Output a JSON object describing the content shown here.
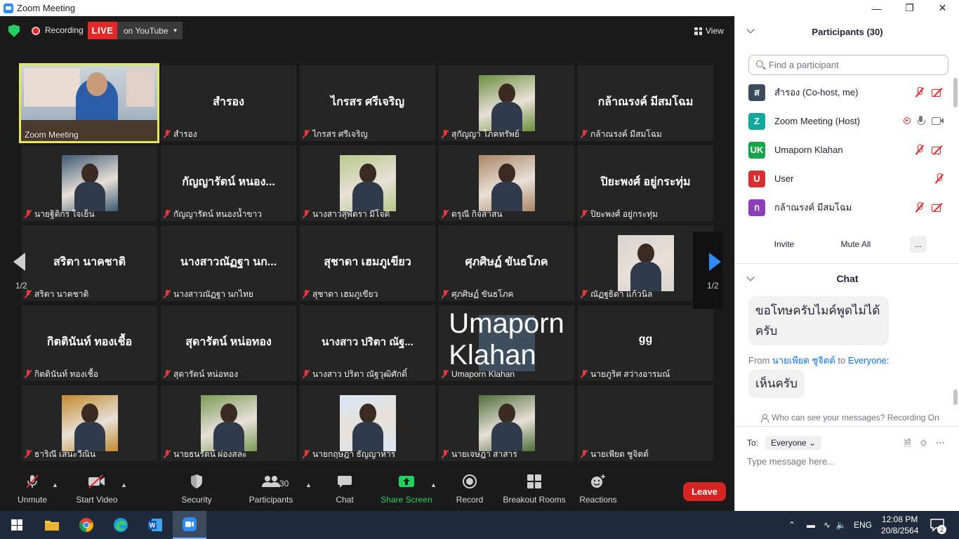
{
  "window": {
    "title": "Zoom Meeting"
  },
  "topbar": {
    "recording_label": "Recording",
    "live_label": "LIVE",
    "live_target": "on YouTube",
    "view_label": "View"
  },
  "self_video_label": "Zoom Meeting",
  "tiles": [
    {
      "name": "สำรอง",
      "label": "สำรอง"
    },
    {
      "name": "ไกรสร ศรีเจริญ",
      "label": "ไกรสร ศรีเจริญ"
    },
    {
      "name": "",
      "label": "สุกัญญา โภคทรัพย์"
    },
    {
      "name": "กล้าณรงค์ มีสมโฉม",
      "label": "กล้าณรงค์ มีสมโฉม"
    },
    {
      "name": "",
      "label": "นายฐิติกร ใจเย็น"
    },
    {
      "name": "กัญญารัตน์ หนอง...",
      "label": "กัญญารัตน์ หนองน้ำขาว"
    },
    {
      "name": "",
      "label": "นางสาวสุพัตรา มีโจติ"
    },
    {
      "name": "",
      "label": "ดรุณี กิจสาสน"
    },
    {
      "name": "ปิยะพงศ์ อยู่กระทุ่ม",
      "label": "ปิยะพงศ์ อยู่กระทุ่ม"
    },
    {
      "name": "สริตา  นาคชาติ",
      "label": "สริตา  นาคชาติ"
    },
    {
      "name": "นางสาวณัฏฐา นก...",
      "label": "นางสาวณัฏฐา นกไทย"
    },
    {
      "name": "สุชาดา เฮมภูเขียว",
      "label": "สุชาดา เฮมภูเขียว"
    },
    {
      "name": "ศุภศิษฏ์ ขันธโภค",
      "label": "ศุภศิษฏ์ ขันธโภค"
    },
    {
      "name": "",
      "label": "ณัฏฐธิดา แก้วนิล"
    },
    {
      "name": "กิตตินันท์ ทองเชื้อ",
      "label": "กิตตินันท์ ทองเชื้อ"
    },
    {
      "name": "สุดารัตน์ หน่อทอง",
      "label": "สุดารัตน์ หน่อทอง"
    },
    {
      "name": "นางสาว ปริตา ณัฐ...",
      "label": "นางสาว ปริตา ณัฐวุฒิศักดิ์"
    },
    {
      "name": "Umaporn Klahan",
      "label": "Umaporn Klahan"
    },
    {
      "name": "gg",
      "label": "นายภูริศ สว่างอารมณ์"
    },
    {
      "name": "ธาริณี เสนะวีณิน",
      "label": "ธาริณี เสนะวีณิน"
    },
    {
      "name": "",
      "label": "นายธนรัตน์ ผ่องสละ"
    },
    {
      "name": "",
      "label": "นายกฤษฎา ธัญญาหาร"
    },
    {
      "name": "",
      "label": "นายเจษฎา สาสาร"
    },
    {
      "name": "",
      "label": "นายเพียด ชูจิตต์"
    }
  ],
  "pagination": {
    "left": "1/2",
    "right": "1/2"
  },
  "toolbar": {
    "unmute": "Unmute",
    "start_video": "Start Video",
    "security": "Security",
    "participants": "Participants",
    "participants_count": "30",
    "chat": "Chat",
    "share_screen": "Share Screen",
    "record": "Record",
    "breakout_rooms": "Breakout Rooms",
    "reactions": "Reactions",
    "leave": "Leave"
  },
  "participants_panel": {
    "title": "Participants (30)",
    "search_placeholder": "Find a participant",
    "items": [
      {
        "initial": "ส",
        "name": "สำรอง (Co-host, me)",
        "color": "#3d4a5c"
      },
      {
        "initial": "Z",
        "name": "Zoom Meeting (Host)",
        "color": "#13a89e"
      },
      {
        "initial": "UK",
        "name": "Umaporn Klahan",
        "color": "#17a34a"
      },
      {
        "initial": "U",
        "name": "User",
        "color": "#d63030"
      },
      {
        "initial": "ก",
        "name": "กล้าณรงค์ มีสมโฉม",
        "color": "#8b3fb8"
      }
    ],
    "invite": "Invite",
    "mute_all": "Mute All",
    "more": "..."
  },
  "chat_panel": {
    "title": "Chat",
    "messages": [
      {
        "text": "ขอโทษครับไมค์พูดไม่ได้ครับ"
      },
      {
        "text": "เห็นครับ"
      }
    ],
    "from_prefix": "From",
    "from_sender": "นายเพียด ชูจิตต์",
    "from_to": "to",
    "from_target": "Everyone:",
    "who_can_see": "Who can see your messages? Recording On",
    "to_label": "To:",
    "to_value": "Everyone",
    "input_placeholder": "Type message here..."
  },
  "taskbar": {
    "lang": "ENG",
    "time": "12:08 PM",
    "date": "20/8/2564",
    "notification_count": "2"
  },
  "colors": {
    "accent": "#2d8cff",
    "live_red": "#e02828",
    "active_speaker": "#e5e858",
    "share_green": "#23d160"
  }
}
